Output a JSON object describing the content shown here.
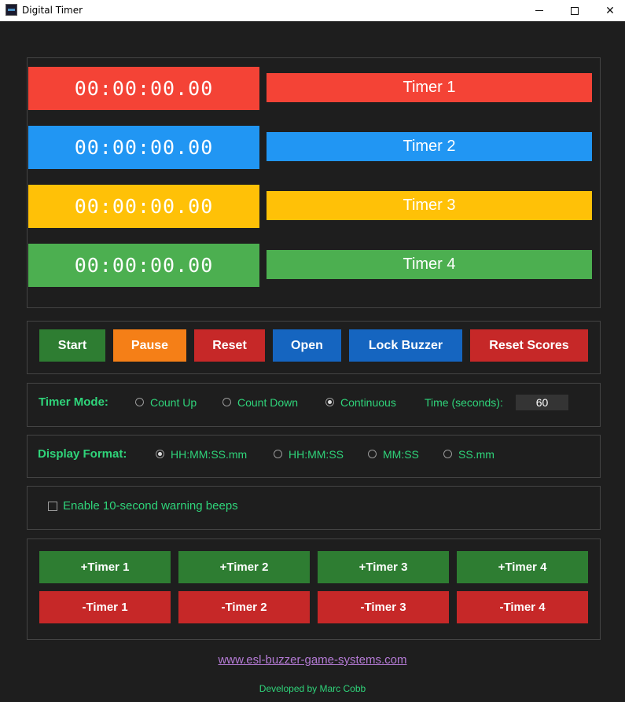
{
  "window": {
    "title": "Digital Timer",
    "controls": {
      "minimize": "minimize",
      "maximize": "maximize",
      "close": "✕"
    }
  },
  "timers": [
    {
      "clock": "00:00:00.00",
      "label": "Timer 1",
      "color": "#f44336"
    },
    {
      "clock": "00:00:00.00",
      "label": "Timer 2",
      "color": "#2196f3"
    },
    {
      "clock": "00:00:00.00",
      "label": "Timer 3",
      "color": "#ffc107"
    },
    {
      "clock": "00:00:00.00",
      "label": "Timer 4",
      "color": "#4caf50"
    }
  ],
  "controls": {
    "start": "Start",
    "pause": "Pause",
    "reset": "Reset",
    "open": "Open",
    "lock_buzzer": "Lock Buzzer",
    "reset_scores": "Reset Scores"
  },
  "timer_mode": {
    "label": "Timer Mode:",
    "options": [
      "Count Up",
      "Count Down",
      "Continuous"
    ],
    "selected": "Continuous",
    "time_label": "Time (seconds):",
    "time_value": "60"
  },
  "display_format": {
    "label": "Display Format:",
    "options": [
      "HH:MM:SS.mm",
      "HH:MM:SS",
      "MM:SS",
      "SS.mm"
    ],
    "selected": "HH:MM:SS.mm"
  },
  "warning": {
    "label": "Enable 10-second warning beeps",
    "checked": false
  },
  "score_buttons": {
    "plus": [
      "+Timer 1",
      "+Timer 2",
      "+Timer 3",
      "+Timer 4"
    ],
    "minus": [
      "-Timer 1",
      "-Timer 2",
      "-Timer 3",
      "-Timer 4"
    ]
  },
  "footer": {
    "link": "www.esl-buzzer-game-systems.com",
    "credit": "Developed by Marc Cobb"
  },
  "colors": {
    "background": "#1e1e1e",
    "accent_green": "#2fd47a",
    "start": "#2e7d32",
    "pause": "#f57f17",
    "reset": "#c62828",
    "open": "#1565c0",
    "lock_buzzer": "#1565c0",
    "reset_scores": "#c62828",
    "plus": "#2e7d32",
    "minus": "#c62828",
    "link": "#b57bd6"
  }
}
